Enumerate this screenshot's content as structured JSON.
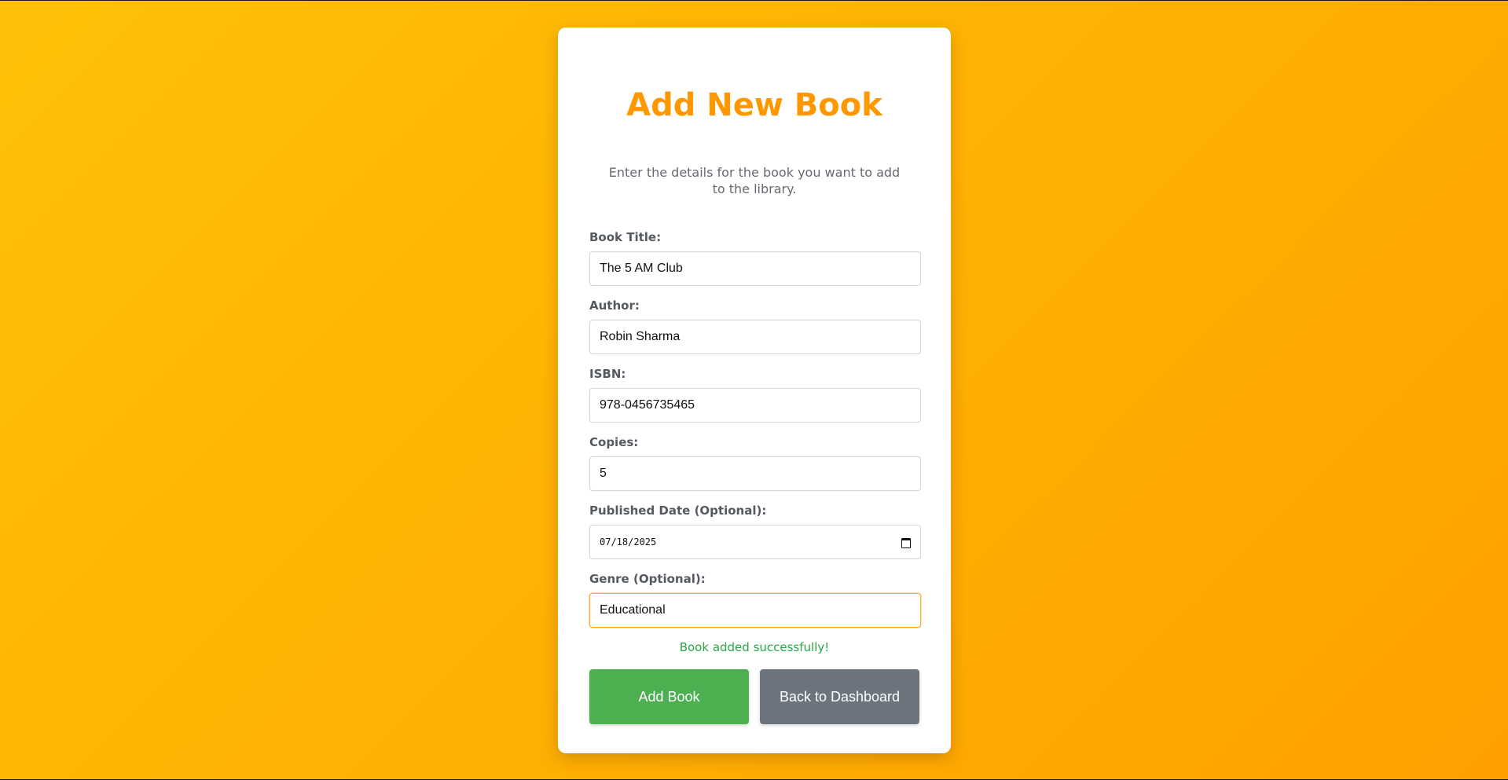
{
  "page": {
    "title": "Add New Book",
    "subtitle": "Enter the details for the book you want to add to the library."
  },
  "form": {
    "fields": [
      {
        "label": "Book Title:",
        "value": "The 5 AM Club",
        "type": "text"
      },
      {
        "label": "Author:",
        "value": "Robin Sharma",
        "type": "text"
      },
      {
        "label": "ISBN:",
        "value": "978-0456735465",
        "type": "text"
      },
      {
        "label": "Copies:",
        "value": "5",
        "type": "number"
      },
      {
        "label": "Published Date (Optional):",
        "value": "07/18/2025",
        "type": "date"
      },
      {
        "label": "Genre (Optional):",
        "value": "Educational",
        "type": "text",
        "focused": true
      }
    ],
    "status_message": "Book added successfully!",
    "add_button_label": "Add Book",
    "back_button_label": "Back to Dashboard"
  },
  "colors": {
    "accent": "#ff9800",
    "success": "#28a745",
    "add_button": "#4caf50",
    "back_button": "#6c757d",
    "background_start": "#ffc107",
    "background_end": "#ffa000"
  },
  "icons": {
    "date_picker": "calendar-icon"
  }
}
